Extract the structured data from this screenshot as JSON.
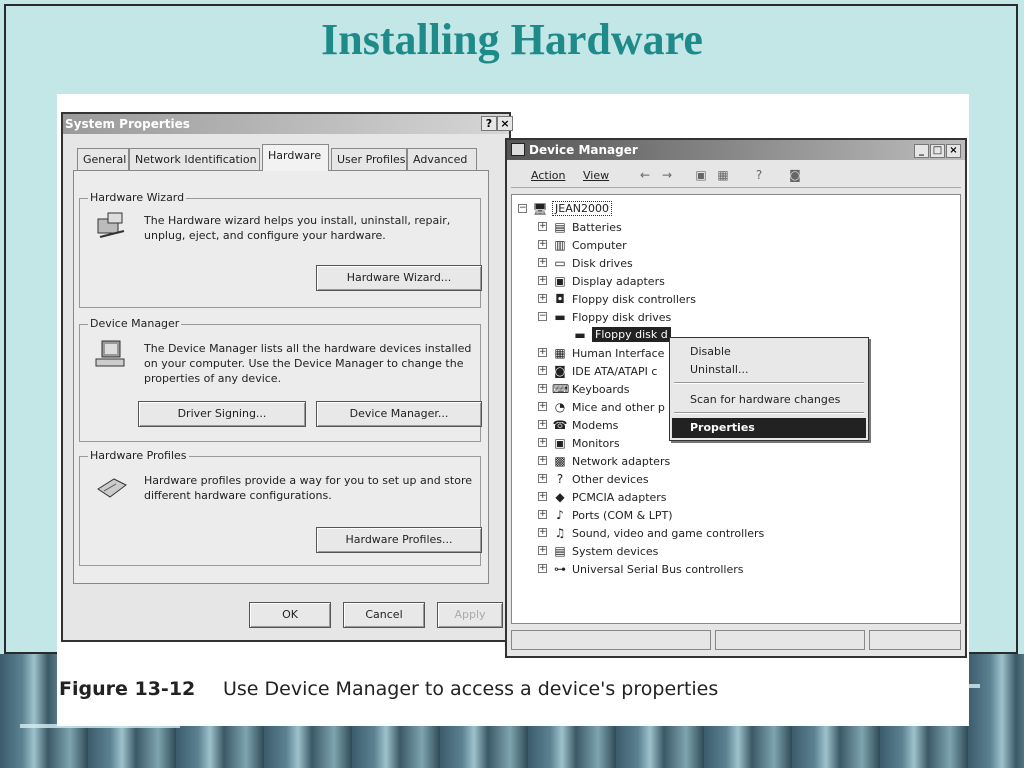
{
  "slide": {
    "title": "Installing Hardware",
    "caption_label": "Figure 13-12",
    "caption_text": "Use Device Manager to access a device's properties"
  },
  "system_properties": {
    "title": "System Properties",
    "help_button": "?",
    "close_button": "×",
    "tabs": [
      "General",
      "Network Identification",
      "Hardware",
      "User Profiles",
      "Advanced"
    ],
    "active_tab": "Hardware",
    "hardware_wizard": {
      "heading": "Hardware Wizard",
      "description": "The Hardware wizard helps you install, uninstall, repair, unplug, eject, and configure your hardware.",
      "button": "Hardware Wizard..."
    },
    "device_manager": {
      "heading": "Device Manager",
      "description": "The Device Manager lists all the hardware devices installed on your computer. Use the Device Manager to change the properties of any device.",
      "driver_signing_button": "Driver Signing...",
      "device_manager_button": "Device Manager..."
    },
    "hardware_profiles": {
      "heading": "Hardware Profiles",
      "description": "Hardware profiles provide a way for you to set up and store different hardware configurations.",
      "button": "Hardware Profiles..."
    },
    "footer_buttons": {
      "ok": "OK",
      "cancel": "Cancel",
      "apply": "Apply"
    }
  },
  "device_manager": {
    "title": "Device Manager",
    "title_buttons": {
      "minimize": "_",
      "maximize": "□",
      "close": "×"
    },
    "menu": {
      "action": "Action",
      "view": "View"
    },
    "toolbar_icons": [
      "back-arrow-icon",
      "forward-arrow-icon",
      "properties-icon",
      "details-icon",
      "help-icon",
      "scan-icon"
    ],
    "root": "JEAN2000",
    "tree": [
      {
        "label": "Batteries",
        "icon": "battery-icon"
      },
      {
        "label": "Computer",
        "icon": "computer-icon"
      },
      {
        "label": "Disk drives",
        "icon": "disk-icon"
      },
      {
        "label": "Display adapters",
        "icon": "display-icon"
      },
      {
        "label": "Floppy disk controllers",
        "icon": "controller-icon"
      },
      {
        "label": "Floppy disk drives",
        "icon": "floppy-icon",
        "expanded": true
      },
      {
        "label": "Floppy disk drive",
        "icon": "floppy-icon",
        "child": true,
        "selected": true
      },
      {
        "label": "Human Interface Devices",
        "icon": "hid-icon"
      },
      {
        "label": "IDE ATA/ATAPI controllers",
        "icon": "ide-icon"
      },
      {
        "label": "Keyboards",
        "icon": "keyboard-icon"
      },
      {
        "label": "Mice and other pointing devices",
        "icon": "mouse-icon"
      },
      {
        "label": "Modems",
        "icon": "modem-icon"
      },
      {
        "label": "Monitors",
        "icon": "monitor-icon"
      },
      {
        "label": "Network adapters",
        "icon": "network-icon"
      },
      {
        "label": "Other devices",
        "icon": "question-icon"
      },
      {
        "label": "PCMCIA adapters",
        "icon": "pcmcia-icon"
      },
      {
        "label": "Ports (COM & LPT)",
        "icon": "port-icon"
      },
      {
        "label": "Sound, video and game controllers",
        "icon": "sound-icon"
      },
      {
        "label": "System devices",
        "icon": "system-icon"
      },
      {
        "label": "Universal Serial Bus controllers",
        "icon": "usb-icon"
      }
    ],
    "tree_visible": {
      "human_interface": "Human Interface",
      "ide": "IDE ATA/ATAPI c",
      "mice": "Mice and other p",
      "floppy_selected": "Floppy disk d"
    }
  },
  "context_menu": {
    "items": [
      "Disable",
      "Uninstall...",
      "Scan for hardware changes",
      "Properties"
    ],
    "highlighted": "Properties"
  }
}
